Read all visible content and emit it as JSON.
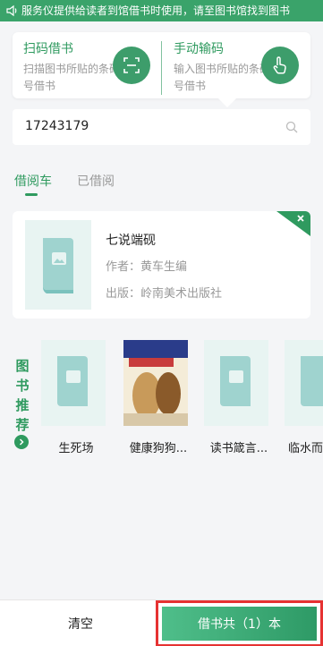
{
  "notice": {
    "text": "服务仪提供给读者到馆借书时使用，请至图书馆找到图书",
    "icon": "speaker-icon"
  },
  "modes": {
    "scan": {
      "title": "扫码借书",
      "desc": "扫描图书所贴的条码号借书",
      "icon": "scan-icon"
    },
    "manual": {
      "title": "手动输码",
      "desc": "输入图书所贴的条码号借书",
      "icon": "hand-tap-icon"
    }
  },
  "search": {
    "value": "17243179",
    "icon": "search-icon"
  },
  "tabs": {
    "cart": "借阅车",
    "borrowed": "已借阅"
  },
  "cart_book": {
    "title": "七说端砚",
    "author": "作者：黄车生编",
    "publisher": "出版：岭南美术出版社"
  },
  "recommend": {
    "label": "图书推荐",
    "items": [
      {
        "name": "生死场"
      },
      {
        "name": "健康狗狗..."
      },
      {
        "name": "读书箴言..."
      },
      {
        "name": "临水而..."
      }
    ]
  },
  "bottom": {
    "clear_label": "清空",
    "borrow_label": "借书共（1）本"
  },
  "colors": {
    "accent": "#2f9a5f",
    "highlight": "#e63232"
  }
}
